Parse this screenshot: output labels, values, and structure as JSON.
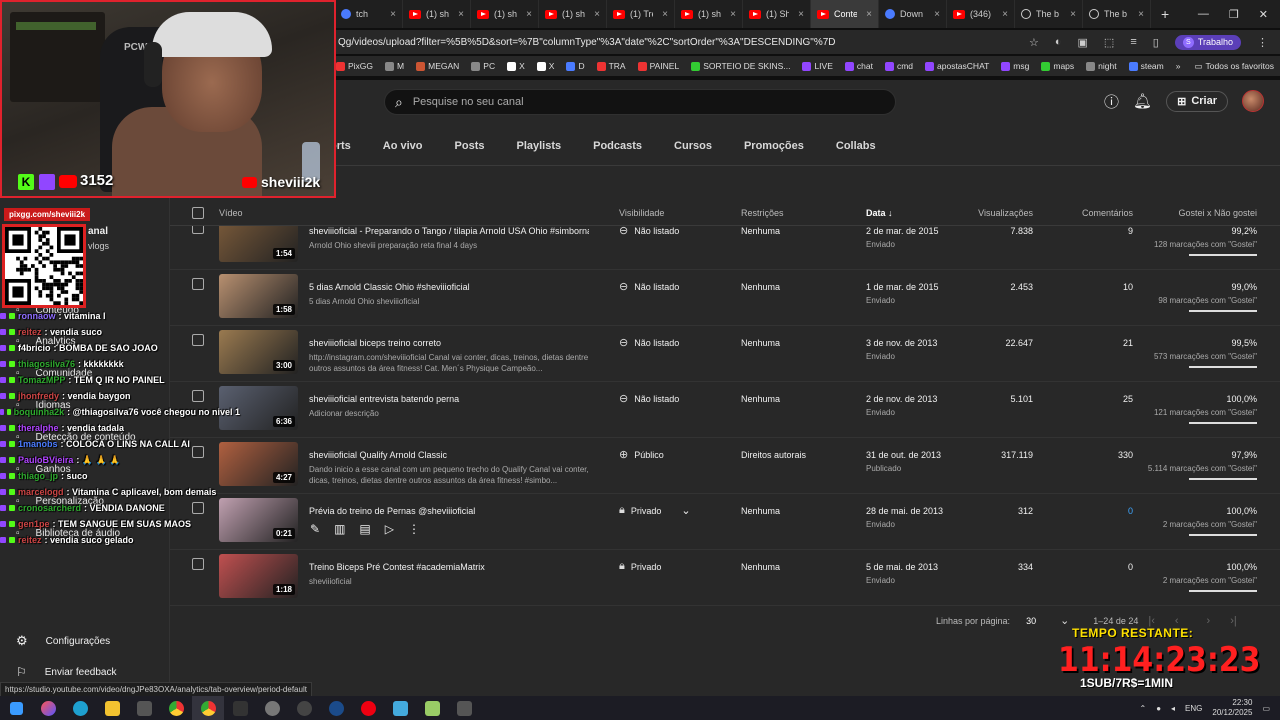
{
  "browser": {
    "tabs": [
      {
        "label": "tch",
        "icon": "blue"
      },
      {
        "label": "(1) she",
        "icon": "yt"
      },
      {
        "label": "(1) she",
        "icon": "yt"
      },
      {
        "label": "(1) she",
        "icon": "yt"
      },
      {
        "label": "(1) Tre",
        "icon": "yt"
      },
      {
        "label": "(1) she",
        "icon": "yt"
      },
      {
        "label": "(1) She",
        "icon": "yt"
      },
      {
        "label": "Conte",
        "icon": "yt",
        "active": true
      },
      {
        "label": "Down",
        "icon": "blue"
      },
      {
        "label": "(346)",
        "icon": "yt"
      },
      {
        "label": "The b",
        "icon": "globe"
      },
      {
        "label": "The b",
        "icon": "globe"
      }
    ],
    "url": "Qg/videos/upload?filter=%5B%5D&sort=%7B\"columnType\"%3A\"date\"%2C\"sortOrder\"%3A\"DESCENDING\"%7D",
    "profile_label": "Trabalho",
    "profile_initial": "S",
    "bookmarks": [
      {
        "label": "PixGG",
        "color": "#e33"
      },
      {
        "label": "M",
        "color": "#888"
      },
      {
        "label": "MEGAN",
        "color": "#c53"
      },
      {
        "label": "PC",
        "color": "#888"
      },
      {
        "label": "X",
        "color": "#fff"
      },
      {
        "label": "X",
        "color": "#fff"
      },
      {
        "label": "D",
        "color": "#4a7bff"
      },
      {
        "label": "TRA",
        "color": "#e33"
      },
      {
        "label": "PAINEL",
        "color": "#e33"
      },
      {
        "label": "SORTEIO DE SKINS...",
        "color": "#3c3"
      },
      {
        "label": "LIVE",
        "color": "#9146ff"
      },
      {
        "label": "chat",
        "color": "#9146ff"
      },
      {
        "label": "cmd",
        "color": "#9146ff"
      },
      {
        "label": "apostasCHAT",
        "color": "#9146ff"
      },
      {
        "label": "msg",
        "color": "#9146ff"
      },
      {
        "label": "maps",
        "color": "#3c3"
      },
      {
        "label": "night",
        "color": "#888"
      },
      {
        "label": "steam",
        "color": "#4a7bff"
      }
    ],
    "bookmarks_all": "Todos os favoritos"
  },
  "header": {
    "search_placeholder": "Pesquise no seu canal",
    "create_label": "Criar"
  },
  "tabs": [
    "orts",
    "Ao vivo",
    "Posts",
    "Playlists",
    "Podcasts",
    "Cursos",
    "Promoções",
    "Collabs"
  ],
  "columns": {
    "video": "Vídeo",
    "visibility": "Visibilidade",
    "restrictions": "Restrições",
    "date": "Data",
    "views": "Visualizações",
    "comments": "Comentários",
    "likes": "Gostei x Não gostei"
  },
  "rows": [
    {
      "title": "sheviiioficial - Preparando o Tango / tilapia Arnold USA Ohio #simborna",
      "desc": "Arnold Ohio sheviii preparação reta final 4 days",
      "duration": "1:54",
      "visibility": "Não listado",
      "restriction": "Nenhuma",
      "date": "2 de mar. de 2015",
      "status": "Enviado",
      "views": "7.838",
      "comments": "9",
      "likes": "99,2%",
      "likes_sub": "128 marcações com \"Gostei\"",
      "thumb": "#7a5a3a"
    },
    {
      "title": "5 dias Arnold Classic Ohio #sheviiioficial",
      "desc": "5 dias Arnold Ohio sheviiioficial",
      "duration": "1:58",
      "visibility": "Não listado",
      "restriction": "Nenhuma",
      "date": "1 de mar. de 2015",
      "status": "Enviado",
      "views": "2.453",
      "comments": "10",
      "likes": "99,0%",
      "likes_sub": "98 marcações com \"Gostei\"",
      "thumb": "#b89070"
    },
    {
      "title": "sheviiioficial biceps treino correto",
      "desc": "http://instagram.com/sheviiioficial Canal vai conter, dicas, treinos, dietas dentre outros assuntos da área fitness! Cat. Men´s Physique Campeão...",
      "duration": "3:00",
      "visibility": "Não listado",
      "restriction": "Nenhuma",
      "date": "3 de nov. de 2013",
      "status": "Enviado",
      "views": "22.647",
      "comments": "21",
      "likes": "99,5%",
      "likes_sub": "573 marcações com \"Gostei\"",
      "thumb": "#9a7a50"
    },
    {
      "title": "sheviiioficial entrevista batendo perna",
      "desc": "Adicionar descrição",
      "duration": "6:36",
      "visibility": "Não listado",
      "restriction": "Nenhuma",
      "date": "2 de nov. de 2013",
      "status": "Enviado",
      "views": "5.101",
      "comments": "25",
      "likes": "100,0%",
      "likes_sub": "121 marcações com \"Gostei\"",
      "thumb": "#5a6070"
    },
    {
      "title": "sheviiioficial Qualify Arnold Classic",
      "desc": "Dando inicio a esse canal com um pequeno trecho do Qualify Canal vai conter, dicas, treinos, dietas dentre outros assuntos da área fitness! #simbo...",
      "duration": "4:27",
      "visibility": "Público",
      "restriction": "Direitos autorais",
      "date": "31 de out. de 2013",
      "status": "Publicado",
      "views": "317.119",
      "comments": "330",
      "likes": "97,9%",
      "likes_sub": "5.114 marcações com \"Gostei\"",
      "thumb": "#b06040"
    },
    {
      "title": "Prévia do treino de Pernas @sheviiioficial",
      "desc": "",
      "duration": "0:21",
      "visibility": "Privado",
      "restriction": "Nenhuma",
      "date": "28 de mai. de 2013",
      "status": "Enviado",
      "views": "312",
      "comments": "0",
      "likes": "100,0%",
      "likes_sub": "2 marcações com \"Gostei\"",
      "thumb": "#c0a0b0"
    },
    {
      "title": "Treino Biceps Pré Contest #academiaMatrix",
      "desc": "sheviiioficial",
      "duration": "1:18",
      "visibility": "Privado",
      "restriction": "Nenhuma",
      "date": "5 de mai. de 2013",
      "status": "Enviado",
      "views": "334",
      "comments": "0",
      "likes": "100,0%",
      "likes_sub": "2 marcações com \"Gostei\"",
      "thumb": "#c05050"
    }
  ],
  "pagination": {
    "rows_label": "Linhas por página:",
    "rows_value": "30",
    "range": "1–24 de 24"
  },
  "sidebar": {
    "channel_label": "anal",
    "channel_sub": "vlogs",
    "items": [
      "Conteúdo",
      "Analytics",
      "Comunidade",
      "Idiomas",
      "Detecção de conteúdo",
      "Ganhos",
      "Personalização",
      "Biblioteca de áudio"
    ],
    "settings": "Configurações",
    "feedback": "Enviar feedback"
  },
  "webcam": {
    "viewers": "3152",
    "handle": "sheviii2k",
    "chair_text": "PCWES"
  },
  "pix_label": "pixgg.com/sheviii2k",
  "chat": [
    {
      "name": "ronnaow",
      "color": "#8f6cff",
      "msg": ": vitamina I"
    },
    {
      "name": "reitez",
      "color": "#cc4444",
      "msg": ": vendia suco"
    },
    {
      "name": "f4bricio",
      "color": "#ffffff",
      "msg": ": BOMBA DE SAO JOAO"
    },
    {
      "name": "thiagosilva76",
      "color": "#2eaa2e",
      "msg": ": kkkkkkkk"
    },
    {
      "name": "TomazMPP",
      "color": "#2eaa2e",
      "msg": ": TEM Q IR NO PAINEL"
    },
    {
      "name": "jhonfredy",
      "color": "#cc4444",
      "msg": ": vendia baygon"
    },
    {
      "name": "boquinha2k",
      "color": "#2eaa2e",
      "msg": ": @thiagosilva76 você chegou no nivel 1"
    },
    {
      "name": "theralphe",
      "color": "#b044ff",
      "msg": ": vendia tadala"
    },
    {
      "name": "1manobs",
      "color": "#4a7bff",
      "msg": ": COLOCA O LINS NA CALL AI"
    },
    {
      "name": "PauloBVieira",
      "color": "#b044ff",
      "msg": ": 🙏 🙏 🙏"
    },
    {
      "name": "thiago_jp",
      "color": "#2eaa2e",
      "msg": ": suco"
    },
    {
      "name": "marcelogd",
      "color": "#cc4444",
      "msg": ": Vitamina C aplicavel, bom demais"
    },
    {
      "name": "cronosarcherd",
      "color": "#2eaa2e",
      "msg": ": VENDIA DANONE"
    },
    {
      "name": "gen1pe",
      "color": "#cc4444",
      "msg": ": TEM SANGUE EM SUAS MAOS"
    },
    {
      "name": "reitez",
      "color": "#cc4444",
      "msg": ": vendia suco gelado"
    }
  ],
  "timer": {
    "title": "TEMPO RESTANTE:",
    "value": "11:14:23:23",
    "sub": "1SUB/7R$=1MIN"
  },
  "status_url": "https://studio.youtube.com/video/dngJPe83OXA/analytics/tab-overview/period-default",
  "taskbar": {
    "lang": "ENG",
    "time": "22:30",
    "date": "20/12/2025"
  },
  "colors": {
    "bg": "#282828",
    "accent_red": "#ff0000",
    "link_blue": "#3ea6ff",
    "timer_yellow": "#ffe100",
    "timer_red": "#ff2020"
  }
}
